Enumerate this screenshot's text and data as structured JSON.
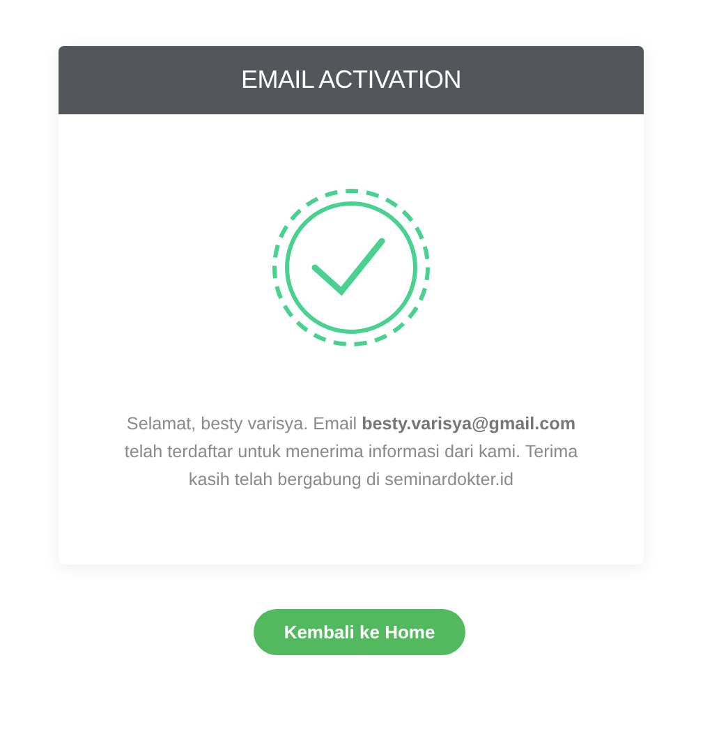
{
  "card": {
    "title": "EMAIL ACTIVATION",
    "message": "Selamat, besty varisya. Email **besty.varisya@gmail.com** telah terdaftar untuk menerima informasi dari kami. Terima kasih telah bergabung di seminardokter.id"
  },
  "button": {
    "label": "Kembali ke Home"
  }
}
